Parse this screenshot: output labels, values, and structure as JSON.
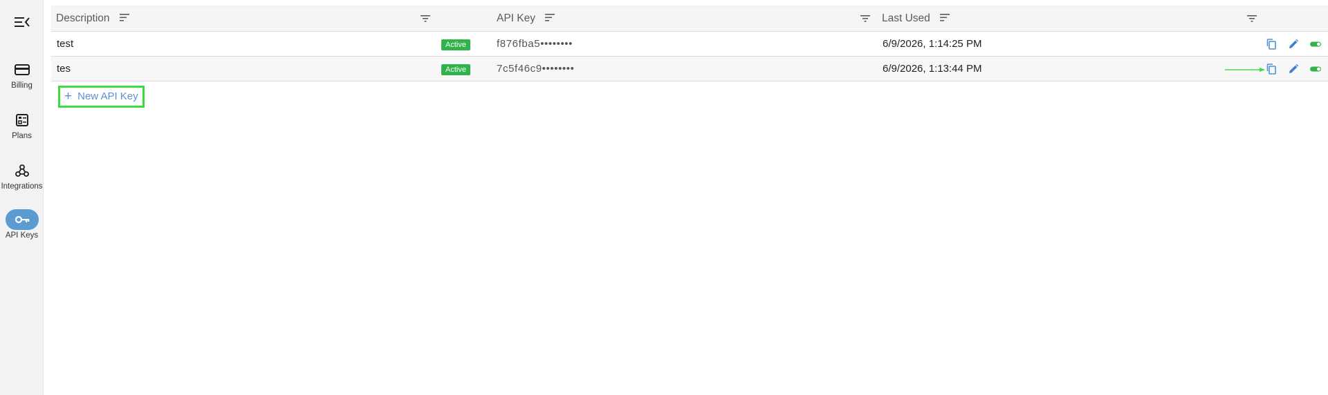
{
  "sidebar": {
    "items": [
      {
        "label": "Billing",
        "icon": "credit-card-icon"
      },
      {
        "label": "Plans",
        "icon": "plans-icon"
      },
      {
        "label": "Integrations",
        "icon": "webhook-icon"
      },
      {
        "label": "API Keys",
        "icon": "key-icon",
        "active": true
      }
    ]
  },
  "grid": {
    "columns": {
      "description": "Description",
      "api_key": "API Key",
      "last_used": "Last Used"
    },
    "rows": [
      {
        "description": "test",
        "status": "Active",
        "api_key": "f876fba5••••••••",
        "last_used": "6/9/2026, 1:14:25 PM"
      },
      {
        "description": "tes",
        "status": "Active",
        "api_key": "7c5f46c9••••••••",
        "last_used": "6/9/2026, 1:13:44 PM"
      }
    ]
  },
  "actions": {
    "new_key_label": "New API Key",
    "plus_symbol": "+"
  },
  "colors": {
    "accent": "#5c9bd1",
    "badge_active": "#2fb34a",
    "link": "#5c8fd6",
    "highlight": "#3bdc3b"
  }
}
